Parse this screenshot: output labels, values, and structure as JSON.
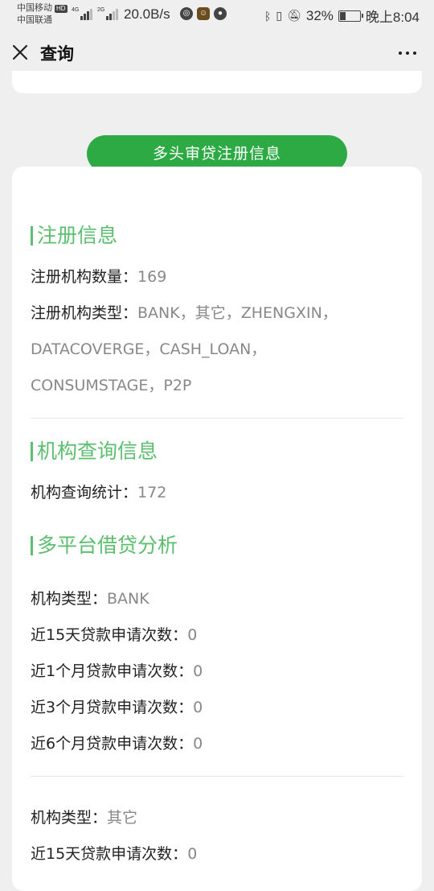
{
  "status_bar": {
    "carrier1": "中国移动",
    "hd": "HD",
    "carrier2": "中国联通",
    "net1": "4G",
    "net2": "2G",
    "speed": "20.0B/s",
    "battery_percent": "32%",
    "battery_level": 0.32,
    "time": "晚上8:04"
  },
  "nav": {
    "title": "查询"
  },
  "header_button": "多头审贷注册信息",
  "register": {
    "title": "注册信息",
    "count_label": "注册机构数量：",
    "count_value": "169",
    "type_label": "注册机构类型：",
    "type_value_line1": "BANK，其它，ZHENGXIN，",
    "type_value_line2": "DATACOVERGE，CASH_LOAN，",
    "type_value_line3": "CONSUMSTAGE，P2P"
  },
  "query": {
    "title": "机构查询信息",
    "stat_label": "机构查询统计：",
    "stat_value": "172"
  },
  "multi": {
    "title": "多平台借贷分析",
    "groups": [
      {
        "type_label": "机构类型：",
        "type_value": "BANK",
        "rows": [
          {
            "label": "近15天贷款申请次数：",
            "value": "0"
          },
          {
            "label": "近1个月贷款申请次数：",
            "value": "0"
          },
          {
            "label": "近3个月贷款申请次数：",
            "value": "0"
          },
          {
            "label": "近6个月贷款申请次数：",
            "value": "0"
          }
        ]
      },
      {
        "type_label": "机构类型：",
        "type_value": "其它",
        "rows": [
          {
            "label": "近15天贷款申请次数：",
            "value": "0"
          }
        ]
      }
    ]
  }
}
